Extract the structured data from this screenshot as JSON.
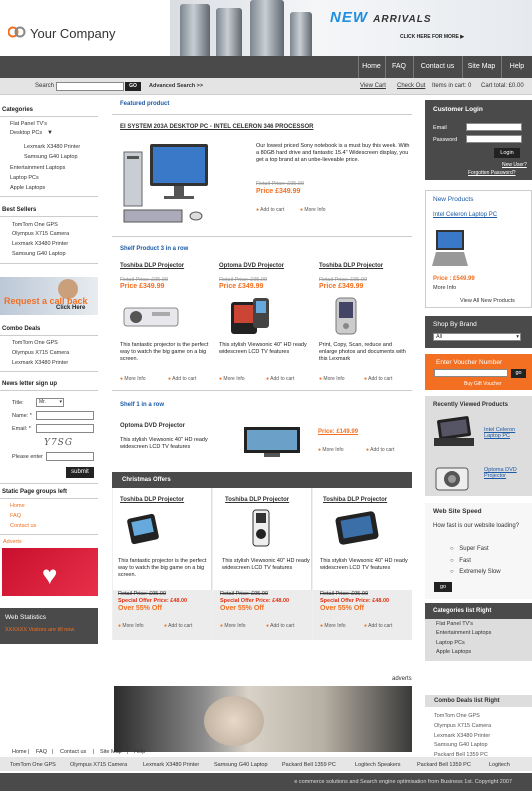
{
  "header": {
    "company": "Your Company",
    "banner_title": "NEW",
    "banner_title2": "ARRIVALS",
    "banner_sub": "CLICK HERE FOR MORE ▶"
  },
  "nav": [
    "Home",
    "FAQ",
    "Contact us",
    "Site Map",
    "Help"
  ],
  "searchbar": {
    "label": "Search",
    "go": "GO",
    "advanced": "Advanced Search >>",
    "view_cart": "View Cart",
    "check_out": "Check Out",
    "items": "Items in cart: 0",
    "total": "Cart total: £0.00"
  },
  "categories": {
    "title": "Categories",
    "items": [
      "Flat Panel TV's",
      "Desktop PCs",
      "Lexmark X3480 Printer",
      "Samsung G40 Laptop",
      "Entertainment Laptops",
      "Laptop PCs",
      "Apple Laptops"
    ]
  },
  "best_sellers": {
    "title": "Best Sellers",
    "items": [
      "TomTom One GPS",
      "Olympus X715 Camera",
      "Lexmark X3480 Printer",
      "Samsung G40 Laptop"
    ]
  },
  "callback": {
    "title": "Request a call back",
    "click": "Click Here"
  },
  "combo": {
    "title": "Combo Deals",
    "items": [
      "TomTom One GPS",
      "Olympus X715 Camera",
      "Lexmark X3480 Printer"
    ]
  },
  "newsletter": {
    "title": "News letter sign up",
    "title_label": "Title:",
    "title_value": "Mr.",
    "name_label": "Name: *",
    "email_label": "Email: *",
    "captcha": "Y7SG",
    "enter_label": "Please enter",
    "submit": "submit"
  },
  "static_pages": {
    "title": "Static Page groups left",
    "items": [
      "Home",
      "FAQ",
      "Contact us"
    ]
  },
  "adverts_left": "Adverts",
  "web_stats": {
    "title": "Web Statistics",
    "text": "XXXXXX Visitors are till now"
  },
  "featured": {
    "heading": "Featured product",
    "title": "EI SYSTEM 203A DESKTOP PC - INTEL CELERON 346 PROCESSOR",
    "desc": "Our lowest priced Sony notebook is a must buy this week. With a 80GB hard drive and fantastic 15.4\" Widescreen display, you get a top brand at an unbe-lieveable price.",
    "retail": "Retail Price: £95.00",
    "price": "Price £349.99",
    "add": "Add to cart",
    "more": "More Info"
  },
  "shelf3": {
    "heading": "Shelf Product 3 in a row",
    "items": [
      {
        "title": "Toshiba DLP Projector",
        "retail": "Retail Price: £95.00",
        "price": "Price £349.99",
        "desc": "This fantastic projector is the perfect way to watch the big game on a big screen."
      },
      {
        "title": "Optoma DVD Projector",
        "retail": "Retail Price: £95.00",
        "price": "Price £349.99",
        "desc": "This stylish Viewsonic 40\" HD ready widescreen LCD TV features"
      },
      {
        "title": "Toshiba DLP Projector",
        "retail": "Retail Price: £95.00",
        "price": "Price £349.99",
        "desc": "Print, Copy, Scan, reduce and enlarge photos and documents with this Lexmark"
      }
    ],
    "more": "More Info",
    "add": "Add to cart"
  },
  "shelf1": {
    "heading": "Shelf 1 in a row",
    "title": "Optoma DVD Projector",
    "desc": "This stylish Viewsonic 40\" HD ready widescreen LCD TV features",
    "price": "Price: £149.99",
    "more": "More Info",
    "add": "Add to cart"
  },
  "christmas": {
    "heading": "Christmas Offers",
    "items": [
      {
        "title": "Toshiba DLP Projector",
        "desc": "This fantastic projector is the perfect way to watch the big game on a big screen.",
        "retail": "Retail Price: £95.00",
        "special": "Special Offer Price: £48.00",
        "off": "Over 55% Off"
      },
      {
        "title": "Toshiba DLP Projector",
        "desc": "This stylish Viewsonic 40\" HD ready widescreen LCD TV features",
        "retail": "Retail Price: £95.00",
        "special": "Special Offer Price: £48.00",
        "off": "Over 55% Off"
      },
      {
        "title": "Toshiba DLP Projector",
        "desc": "This stylish Viewsonic 40\" HD ready widescreen LCD TV features",
        "retail": "Retail Price: £95.00",
        "special": "Special Offer Price: £48.00",
        "off": "Over 55% Off"
      }
    ],
    "more": "More Info",
    "add": "Add to cart"
  },
  "adverts_center": "adverts",
  "customer_login": {
    "title": "Customer Login",
    "email": "Email",
    "password": "Password",
    "login": "Login",
    "new_user": "New User?",
    "forgotten": "Forgotten Password?"
  },
  "new_products": {
    "title": "New Products",
    "name": "Intel Celeron Laptop PC",
    "price": "Price : £549.99",
    "more": "More Info",
    "view_all": "View All New Products"
  },
  "shop_by_brand": {
    "title": "Shop By Brand",
    "value": "All"
  },
  "voucher": {
    "title": "Enter Voucher Number",
    "go": "go",
    "buy": "Buy Gift Voucher"
  },
  "recently": {
    "title": "Recently Viewed Products",
    "items": [
      "Intel Celeron Laptop PC",
      "Optoma DVD Projector"
    ]
  },
  "poll": {
    "title": "Web Site Speed",
    "question": "How fast is our website loading?",
    "options": [
      "Super Fast",
      "Fast",
      "Extremely Slow"
    ],
    "go": "go"
  },
  "cat_right": {
    "title": "Categories list Right",
    "items": [
      "Flat Panel TV's",
      "Entertainment Laptops",
      "Laptop PCs",
      "Apple Laptops"
    ]
  },
  "combo_right": {
    "title": "Combo Deals list Right",
    "items": [
      "TomTom One GPS",
      "Olympus X715 Camera",
      "Lexmark X3480 Printer",
      "Samsung G40 Laptop",
      "Packard Bell 1359 PC"
    ]
  },
  "footer": {
    "links": [
      "Home",
      "FAQ",
      "Contact us",
      "Site Map",
      "Help"
    ],
    "products": [
      "TomTom One GPS",
      "Olympus X715 Camera",
      "Lexmark X3480 Printer",
      "Samsung G40 Laptop",
      "Packard Bell 1359 PC",
      "Logitech Speakers",
      "Packard Bell 1359 PC",
      "Logitech"
    ],
    "copyright": "e commerce solutions and  Search engine optimisation from Business 1st. Copyright 2007"
  }
}
